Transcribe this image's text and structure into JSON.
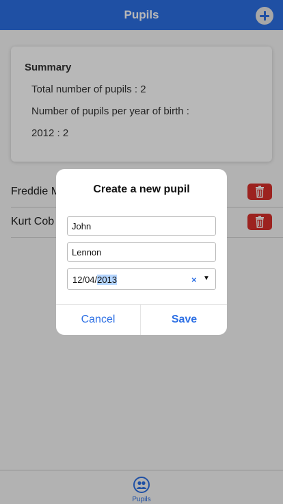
{
  "header": {
    "title": "Pupils",
    "add_icon": "plus-circle-icon"
  },
  "summary": {
    "title": "Summary",
    "total_line": "Total number of pupils : 2",
    "per_year_heading": "Number of pupils per year of birth :",
    "year_counts": [
      "2012 : 2"
    ]
  },
  "pupils": [
    {
      "name": "Freddie M",
      "delete_icon": "trash-icon"
    },
    {
      "name": "Kurt Cob",
      "delete_icon": "trash-icon"
    }
  ],
  "modal": {
    "title": "Create a new pupil",
    "first_name_value": "John",
    "last_name_value": "Lennon",
    "birth_date": {
      "day_month": "12/04/",
      "year": "2013",
      "clear_icon": "×",
      "dropdown_icon": "▼"
    },
    "cancel_label": "Cancel",
    "save_label": "Save"
  },
  "tabbar": {
    "active_tab_label": "Pupils",
    "active_tab_icon": "people-icon"
  },
  "colors": {
    "accent": "#2c6fe4",
    "danger": "#d8302c"
  }
}
